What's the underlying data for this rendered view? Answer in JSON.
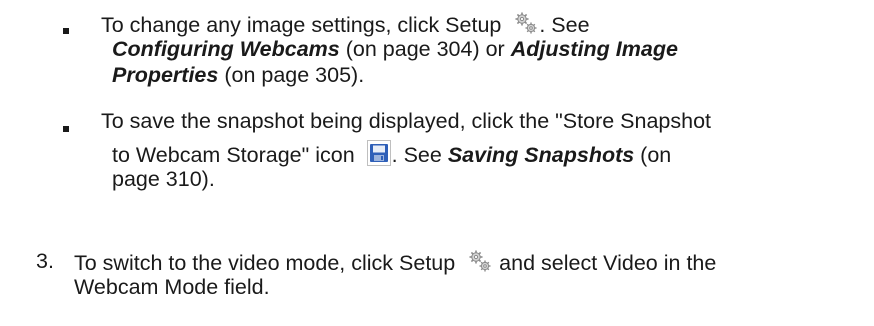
{
  "items": [
    {
      "marker": "bullet",
      "line1": {
        "text_before_icon": "To change any image settings, click Setup ",
        "icon": "gear-icon",
        "text_after_icon": ". See"
      },
      "line2": {
        "link1": "Configuring Webcams",
        "text1": " (on page 304) or ",
        "link2": "Adjusting Image"
      },
      "line3": {
        "link2_cont": "Properties",
        "text2": " (on page 305)."
      }
    },
    {
      "marker": "bullet",
      "line1": {
        "text": "To save the snapshot being displayed, click the \"Store Snapshot"
      },
      "line2": {
        "text_before_icon": "to Webcam Storage\" icon ",
        "icon": "save-icon",
        "text_after_icon": ". See ",
        "link": "Saving Snapshots",
        "text_end": " (on"
      },
      "line3": {
        "text": "page 310)."
      }
    },
    {
      "marker": "3.",
      "line1": {
        "text_before_icon": "To switch to the video mode, click Setup ",
        "icon": "gear-icon",
        "text_after_icon": " and select Video in the"
      },
      "line2": {
        "text": "Webcam Mode field."
      }
    }
  ],
  "colors": {
    "text": "#1a1a1a",
    "save_icon_blue": "#2e5fb8",
    "gear_gray": "#8a8a8a"
  }
}
